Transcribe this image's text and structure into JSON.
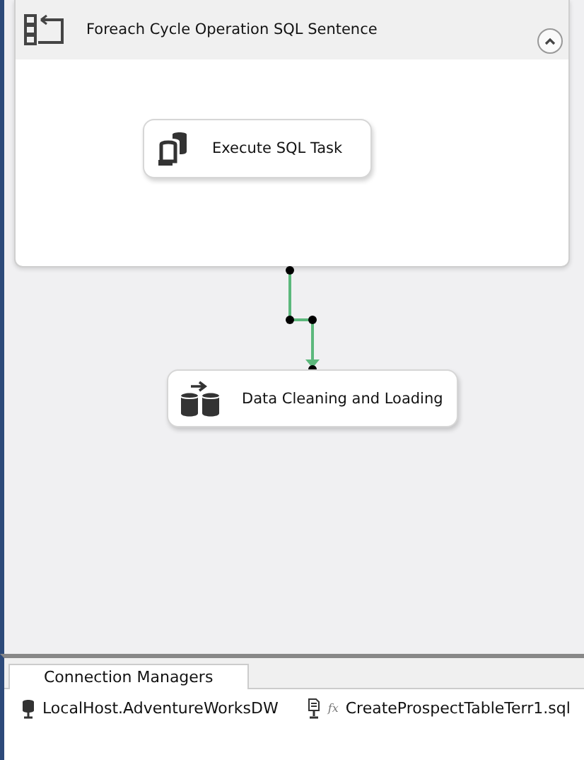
{
  "container": {
    "title": "Foreach Cycle Operation SQL Sentence",
    "expanded": true,
    "tasks": [
      {
        "name": "Execute SQL Task",
        "kind": "sql"
      }
    ]
  },
  "tasks": [
    {
      "name": "Data Cleaning and Loading",
      "kind": "dataflow"
    }
  ],
  "connection_managers": {
    "tab": "Connection Managers",
    "items": [
      {
        "name": "LocalHost.AdventureWorksDW",
        "kind": "database"
      },
      {
        "name": "CreateProspectTableTerr1.sql",
        "kind": "file",
        "expression_mark": "fx"
      }
    ]
  }
}
